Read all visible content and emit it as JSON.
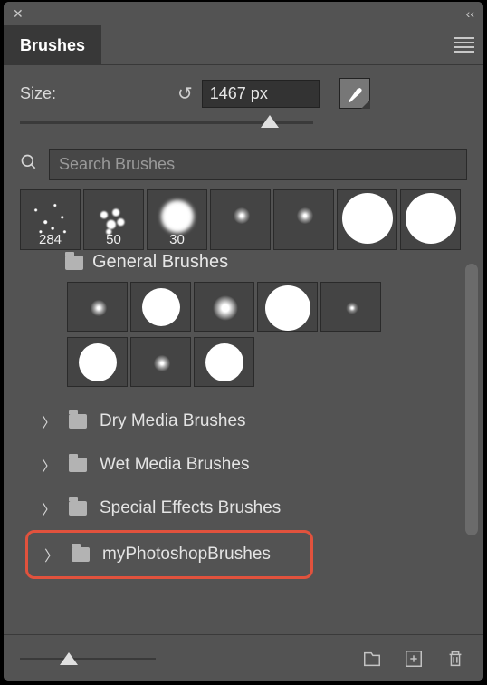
{
  "titlebar": {
    "collapse_glyph": "‹‹"
  },
  "tab": {
    "title": "Brushes"
  },
  "size": {
    "label": "Size:",
    "value": "1467 px"
  },
  "search": {
    "placeholder": "Search Brushes"
  },
  "strip": [
    {
      "label": "284"
    },
    {
      "label": "50"
    },
    {
      "label": "30"
    },
    {
      "label": ""
    },
    {
      "label": ""
    },
    {
      "label": ""
    },
    {
      "label": ""
    }
  ],
  "general": {
    "label": "General Brushes"
  },
  "folders": [
    {
      "label": "Dry Media Brushes"
    },
    {
      "label": "Wet Media Brushes"
    },
    {
      "label": "Special Effects Brushes"
    },
    {
      "label": "myPhotoshopBrushes"
    }
  ]
}
